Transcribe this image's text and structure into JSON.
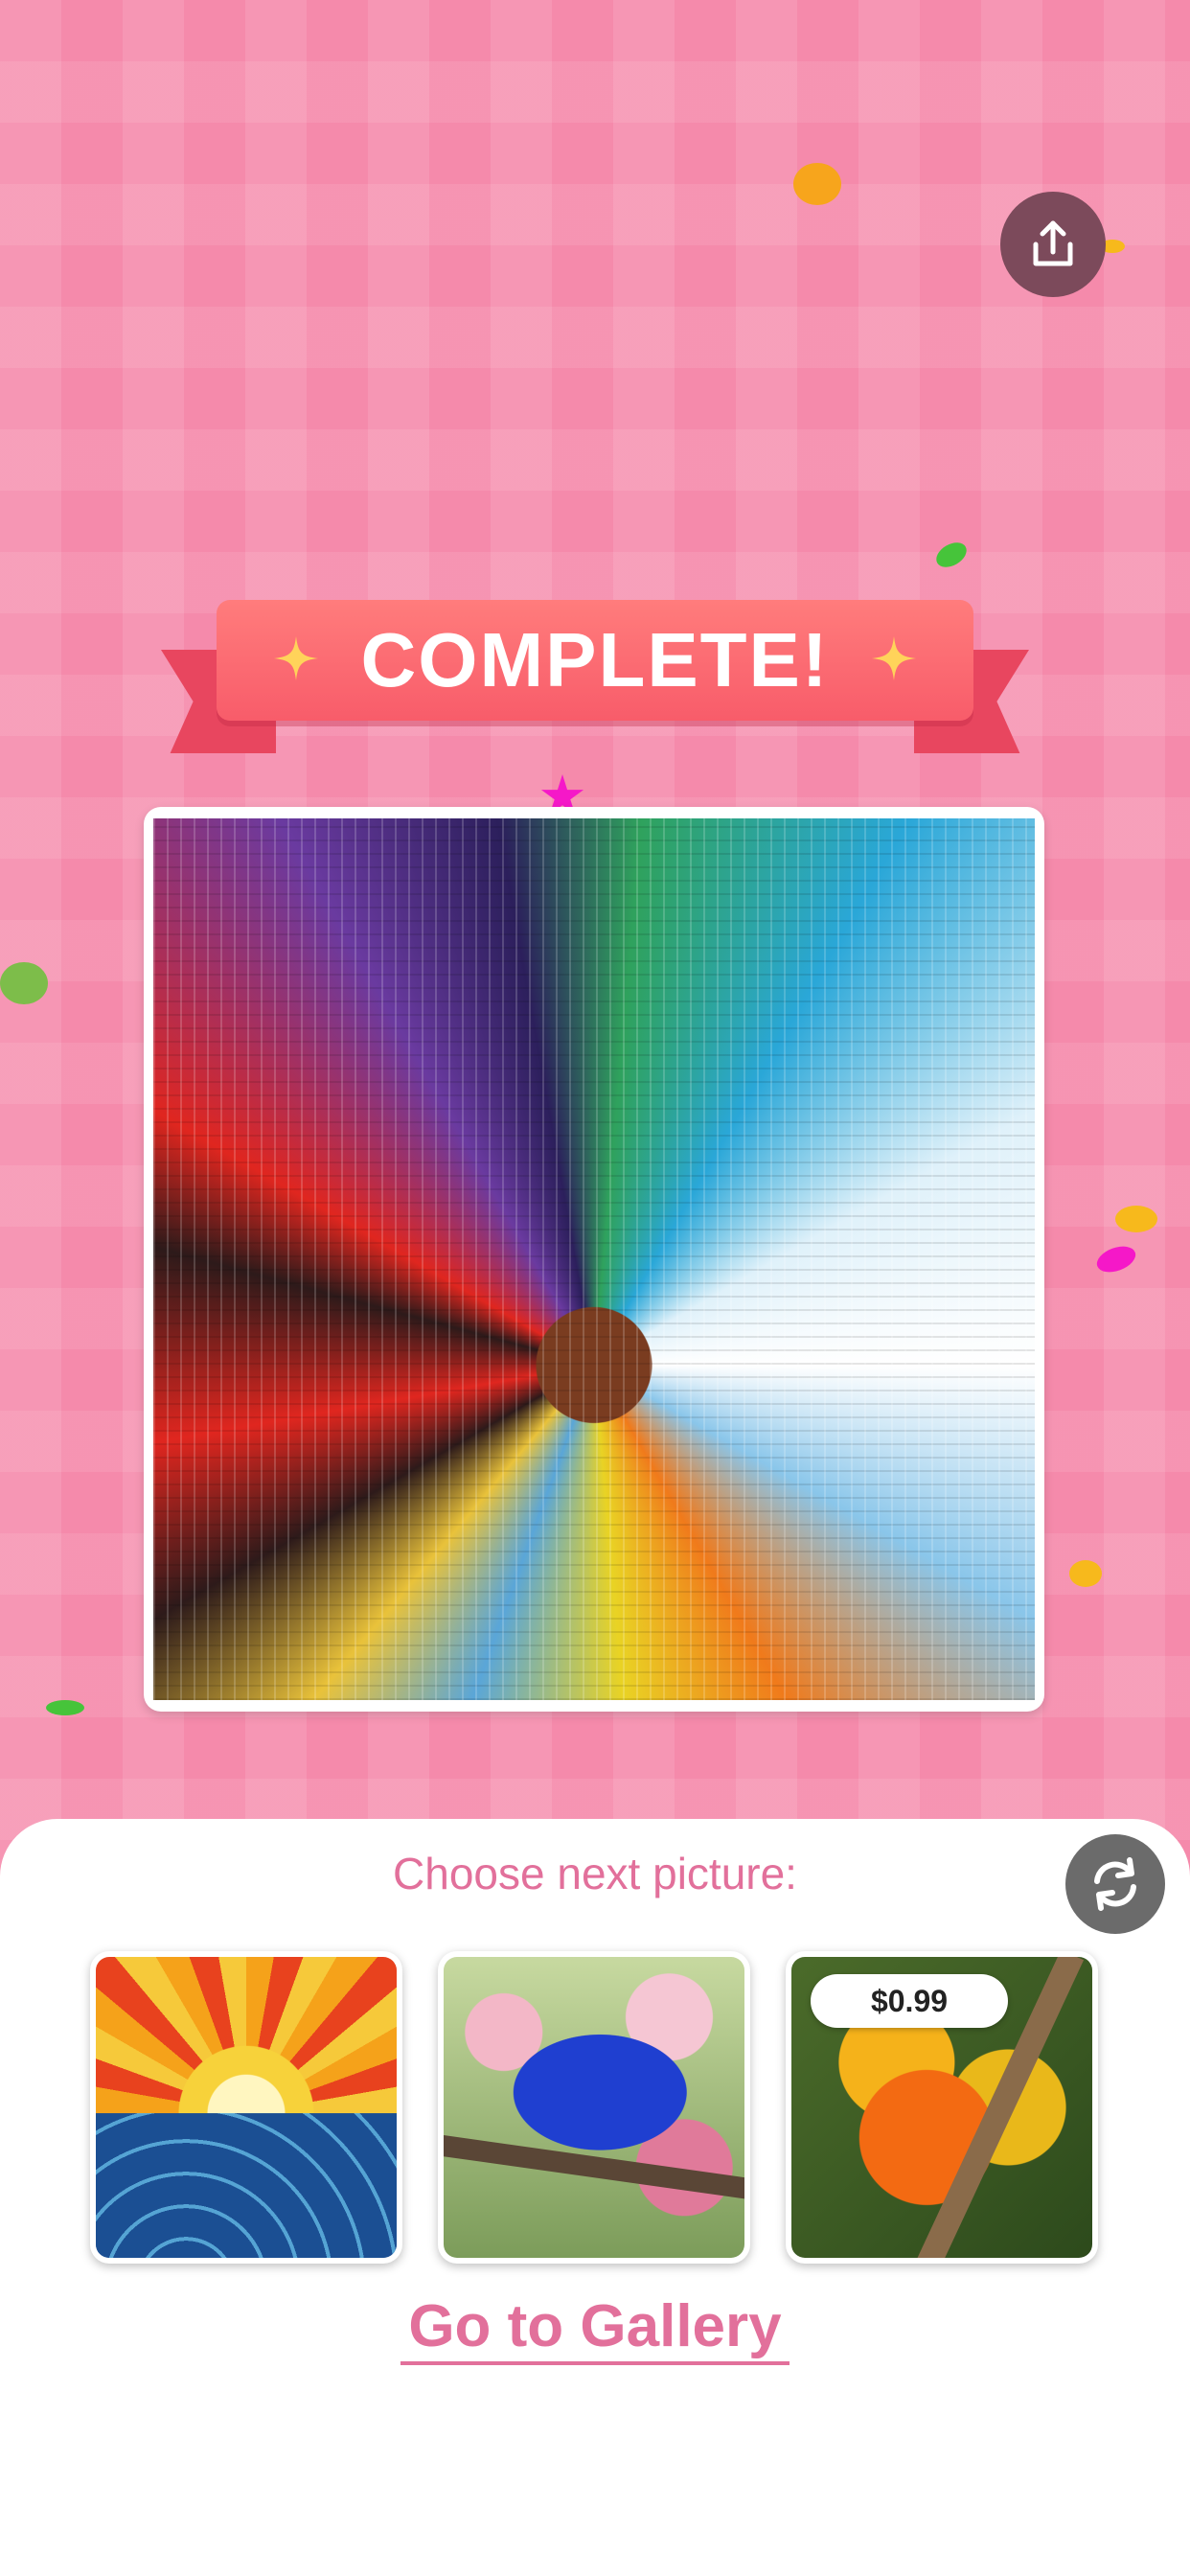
{
  "banner": {
    "title": "COMPLETE!"
  },
  "share": {
    "icon": "share-icon"
  },
  "artwork": {
    "description_icon": "completed-artwork"
  },
  "next_panel": {
    "label": "Choose next picture:",
    "refresh_icon": "refresh-icon",
    "thumbnails": [
      {
        "name": "sunset-over-waves",
        "price": ""
      },
      {
        "name": "blue-bird-on-branch",
        "price": ""
      },
      {
        "name": "parrots-pair",
        "price": "$0.99"
      }
    ],
    "gallery_link": "Go to Gallery"
  },
  "colors": {
    "background": "#f58aab",
    "accent": "#e2709b",
    "banner": "#f85c6a"
  }
}
